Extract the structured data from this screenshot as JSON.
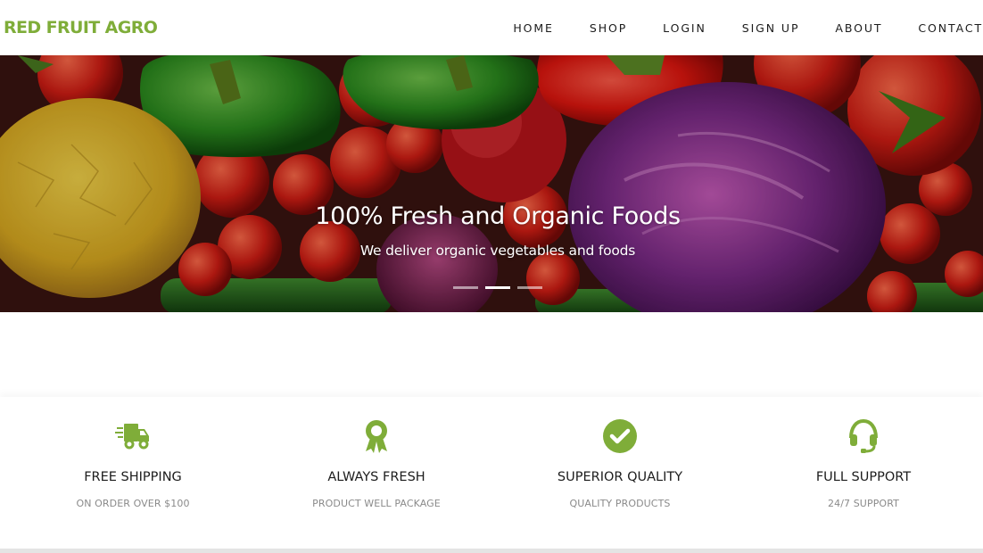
{
  "brand": "RED FRUIT AGRO",
  "nav": {
    "items": [
      "HOME",
      "SHOP",
      "LOGIN",
      "SIGN UP",
      "ABOUT",
      "CONTACT"
    ]
  },
  "hero": {
    "title": "100% Fresh and Organic Foods",
    "subtitle": "We deliver organic vegetables and foods",
    "slides": 3,
    "active_slide": 2
  },
  "features": [
    {
      "icon": "truck-icon",
      "title": "FREE SHIPPING",
      "subtitle": "ON ORDER OVER $100"
    },
    {
      "icon": "award-ribbon-icon",
      "title": "ALWAYS FRESH",
      "subtitle": "PRODUCT WELL PACKAGE"
    },
    {
      "icon": "check-circle-icon",
      "title": "SUPERIOR QUALITY",
      "subtitle": "QUALITY PRODUCTS"
    },
    {
      "icon": "headset-icon",
      "title": "FULL SUPPORT",
      "subtitle": "24/7 SUPPORT"
    }
  ],
  "colors": {
    "accent": "#7fad39",
    "text": "#1c1c1c",
    "muted": "#8a8a8a"
  }
}
